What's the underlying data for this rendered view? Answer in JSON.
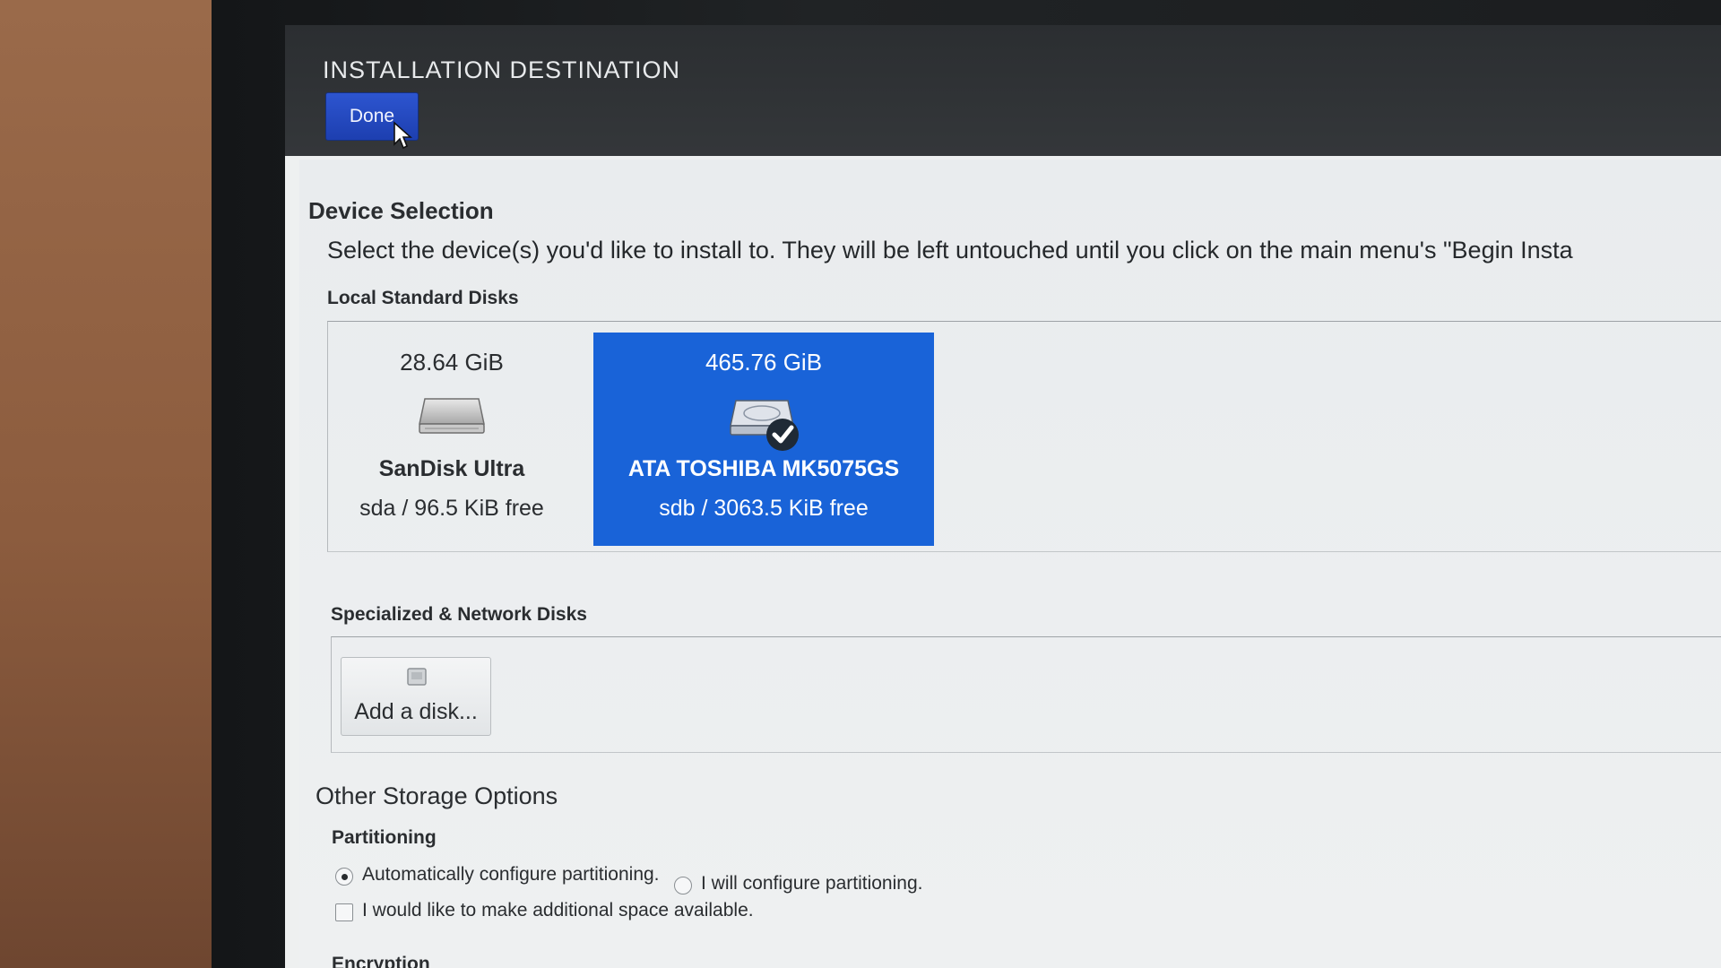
{
  "spoke": {
    "title": "INSTALLATION DESTINATION",
    "done_label": "Done"
  },
  "device_selection": {
    "title": "Device Selection",
    "instructions": "Select the device(s) you'd like to install to.  They will be left untouched until you click on the main menu's \"Begin Insta"
  },
  "local_disks": {
    "label": "Local Standard Disks",
    "disks": [
      {
        "size": "28.64 GiB",
        "name": "SanDisk Ultra",
        "info": "sda  /  96.5 KiB free",
        "icon": "drive-icon",
        "selected": false
      },
      {
        "size": "465.76 GiB",
        "name": "ATA TOSHIBA MK5075GS",
        "info": "sdb   /   3063.5 KiB free",
        "icon": "drive-icon",
        "selected": true
      }
    ]
  },
  "specialized": {
    "label": "Specialized & Network Disks",
    "add_disk_label": "Add a disk..."
  },
  "other_options": {
    "title": "Other Storage Options",
    "partitioning_label": "Partitioning",
    "auto_label": "Automatically configure partitioning.",
    "manual_label": "I will configure partitioning.",
    "space_label": "I would like to make additional space available.",
    "auto_selected": true,
    "space_checked": false,
    "encryption_label": "Encryption"
  },
  "colors": {
    "accent": "#1963d8",
    "done_button": "#1d3fb0",
    "header": "#2b2e31"
  }
}
